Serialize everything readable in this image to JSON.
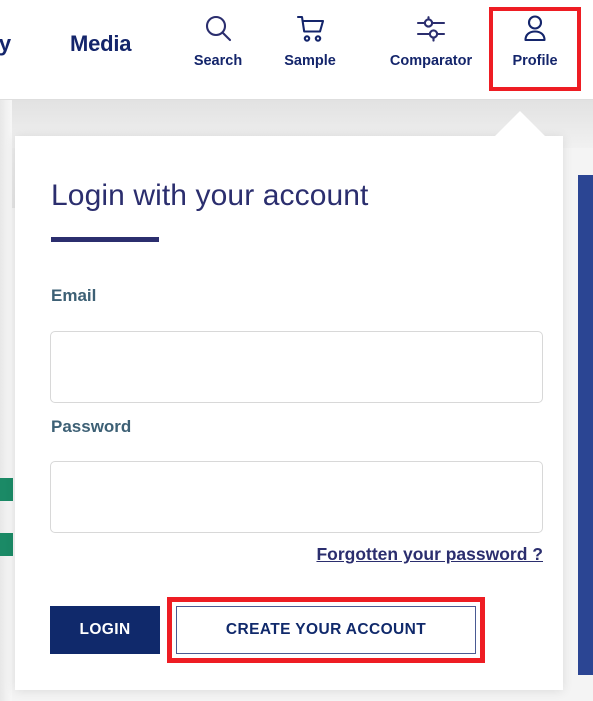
{
  "header": {
    "nav_links": [
      {
        "label": "ility",
        "name": "nav-link-ability"
      },
      {
        "label": "Media",
        "name": "nav-link-media"
      }
    ],
    "icon_items": [
      {
        "label": "Search",
        "icon": "search-icon"
      },
      {
        "label": "Sample",
        "icon": "shopping-cart-icon"
      },
      {
        "label": "Comparator",
        "icon": "sliders-icon"
      },
      {
        "label": "Profile",
        "icon": "user-icon"
      }
    ]
  },
  "login_panel": {
    "title": "Login with your account",
    "email": {
      "label": "Email",
      "value": "",
      "placeholder": ""
    },
    "password": {
      "label": "Password",
      "value": "",
      "placeholder": ""
    },
    "forgot_password_link": "Forgotten your password ?",
    "login_button": "LOGIN",
    "create_account_button": "CREATE YOUR ACCOUNT"
  },
  "colors": {
    "navy": "#10296b",
    "indigo": "#2b2e6e",
    "label_slate": "#3d6075",
    "highlight_red": "#ee1d23",
    "accent_blue_bar": "#2b4593",
    "accent_green": "#1b8a66"
  }
}
